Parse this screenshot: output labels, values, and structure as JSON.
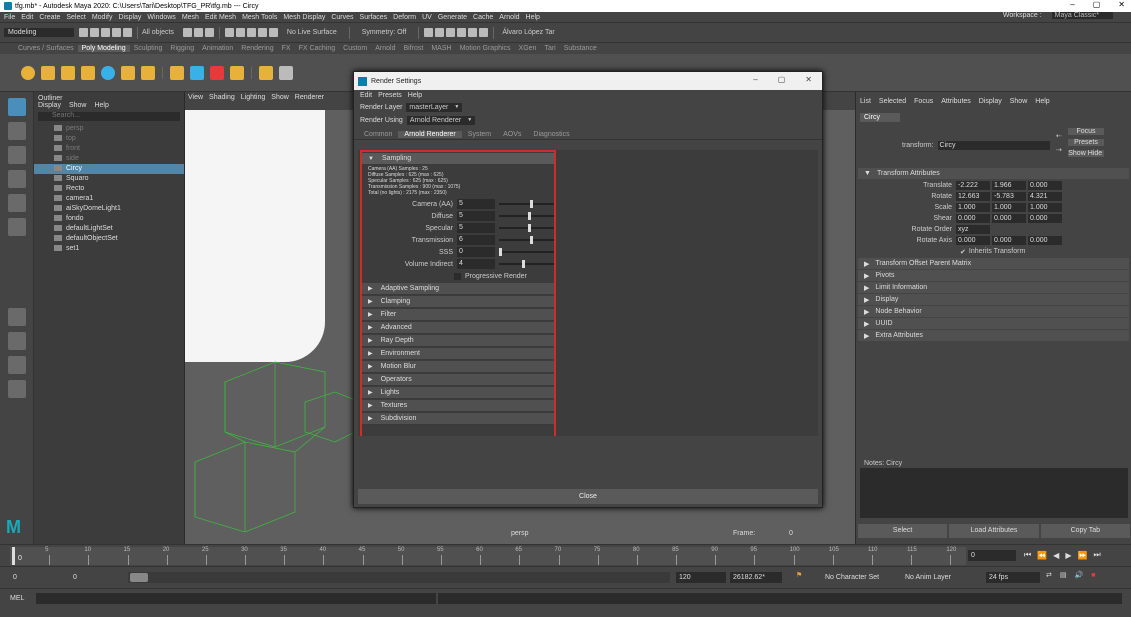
{
  "window": {
    "title": "tfg.mb* - Autodesk Maya 2020: C:\\Users\\Tari\\Desktop\\TFG_PR\\tfg.mb  ---  Circy",
    "controls": [
      "–",
      "▢",
      "✕"
    ]
  },
  "menubar": {
    "items": [
      "File",
      "Edit",
      "Create",
      "Select",
      "Modify",
      "Display",
      "Windows",
      "Mesh",
      "Edit Mesh",
      "Mesh Tools",
      "Mesh Display",
      "Curves",
      "Surfaces",
      "Deform",
      "UV",
      "Generate",
      "Cache",
      "Arnold",
      "Help"
    ],
    "workspace_label": "Workspace :",
    "workspace_value": "Maya Classic*"
  },
  "statusline": {
    "menuset": "Modeling",
    "select_mode": "All objects",
    "live_surface": "No Live Surface",
    "symmetry": "Symmetry: Off",
    "user": "Álvaro López Tar"
  },
  "shelf": {
    "tabs": [
      "Curves / Surfaces",
      "Poly Modeling",
      "Sculpting",
      "Rigging",
      "Animation",
      "Rendering",
      "FX",
      "FX Caching",
      "Custom",
      "Arnold",
      "Bifrost",
      "MASH",
      "Motion Graphics",
      "XGen",
      "Tari",
      "Substance"
    ],
    "active_tab": "Poly Modeling",
    "icon_colors": [
      "#e8b23a",
      "#e8b23a",
      "#e8b23a",
      "#e8b23a",
      "#3ab0e8",
      "#3ab0e8",
      "#e8b23a",
      "#e8b23a",
      "#e83a3a",
      "#3ab0e8",
      "#e8b23a",
      "#e8b23a"
    ]
  },
  "outliner": {
    "title": "Outliner",
    "menu": [
      "Display",
      "Show",
      "Help"
    ],
    "search_placeholder": "Search...",
    "items": [
      {
        "label": "persp",
        "state": "dim"
      },
      {
        "label": "top",
        "state": "dim"
      },
      {
        "label": "front",
        "state": "dim"
      },
      {
        "label": "side",
        "state": "dim"
      },
      {
        "label": "Circy",
        "state": "sel"
      },
      {
        "label": "Squaro",
        "state": "normal"
      },
      {
        "label": "Recto",
        "state": "normal"
      },
      {
        "label": "camera1",
        "state": "normal"
      },
      {
        "label": "aiSkyDomeLight1",
        "state": "normal"
      },
      {
        "label": "fondo",
        "state": "normal"
      },
      {
        "label": "defaultLightSet",
        "state": "normal"
      },
      {
        "label": "defaultObjectSet",
        "state": "normal"
      },
      {
        "label": "set1",
        "state": "normal"
      }
    ]
  },
  "viewport": {
    "menu": [
      "View",
      "Shading",
      "Lighting",
      "Show",
      "Renderer"
    ],
    "camera_label": "persp",
    "frame_label": "Frame:",
    "frame_value": "0"
  },
  "render_settings": {
    "title": "Render Settings",
    "menu": [
      "Edit",
      "Presets",
      "Help"
    ],
    "render_layer_label": "Render Layer",
    "render_layer_value": "masterLayer",
    "render_using_label": "Render Using",
    "render_using_value": "Arnold Renderer",
    "tabs": [
      "Common",
      "Arnold Renderer",
      "System",
      "AOVs",
      "Diagnostics"
    ],
    "active_tab": "Arnold Renderer",
    "sampling_title": "Sampling",
    "stats": [
      "Camera (AA) Samples : 25",
      "Diffuse Samples : 625 (max : 625)",
      "Specular Samples : 625 (max : 625)",
      "Transmission Samples : 900 (max : 1075)",
      "Total (no lights) : 2175 (max : 2350)"
    ],
    "attrs": [
      {
        "label": "Camera (AA)",
        "value": "5",
        "fraction": 0.6
      },
      {
        "label": "Diffuse",
        "value": "5",
        "fraction": 0.55
      },
      {
        "label": "Specular",
        "value": "5",
        "fraction": 0.55
      },
      {
        "label": "Transmission",
        "value": "6",
        "fraction": 0.6
      },
      {
        "label": "SSS",
        "value": "0",
        "fraction": 0.0
      },
      {
        "label": "Volume Indirect",
        "value": "4",
        "fraction": 0.45
      }
    ],
    "progressive_label": "Progressive Render",
    "sampling_subsections": [
      "Adaptive Sampling",
      "Clamping",
      "Filter",
      "Advanced"
    ],
    "sections": [
      "Ray Depth",
      "Environment",
      "Motion Blur",
      "Operators",
      "Lights",
      "Textures",
      "Subdivision"
    ],
    "close_label": "Close"
  },
  "attribute_editor": {
    "menu": [
      "List",
      "Selected",
      "Focus",
      "Attributes",
      "Display",
      "Show",
      "Help"
    ],
    "node_tab": "Circy",
    "transform_label": "transform:",
    "transform_value": "Circy",
    "focus_label": "Focus",
    "presets_label": "Presets",
    "show_label": "Show",
    "hide_label": "Hide",
    "transform_section": "Transform Attributes",
    "translate": {
      "label": "Translate",
      "values": [
        "-2.222",
        "1.966",
        "0.000"
      ]
    },
    "rotate": {
      "label": "Rotate",
      "values": [
        "12.663",
        "-5.783",
        "4.321"
      ]
    },
    "scale": {
      "label": "Scale",
      "values": [
        "1.000",
        "1.000",
        "1.000"
      ]
    },
    "shear": {
      "label": "Shear",
      "values": [
        "0.000",
        "0.000",
        "0.000"
      ]
    },
    "rotate_order": {
      "label": "Rotate Order",
      "value": "xyz"
    },
    "rotate_axis": {
      "label": "Rotate Axis",
      "values": [
        "0.000",
        "0.000",
        "0.000"
      ]
    },
    "inherits": "Inherits Transform",
    "sections": [
      "Transform Offset Parent Matrix",
      "Pivots",
      "Limit Information",
      "Display",
      "Node Behavior",
      "UUID",
      "Extra Attributes"
    ],
    "notes_label": "Notes: Circy",
    "buttons": [
      "Select",
      "Load Attributes",
      "Copy Tab"
    ]
  },
  "timeslider": {
    "ticks": [
      "5",
      "10",
      "15",
      "20",
      "25",
      "30",
      "35",
      "40",
      "45",
      "50",
      "55",
      "60",
      "65",
      "70",
      "75",
      "80",
      "85",
      "90",
      "95",
      "100",
      "105",
      "110",
      "115",
      "120"
    ],
    "current_frame": "0",
    "frame_field": "0"
  },
  "rangeslider": {
    "start": "0",
    "start2": "0",
    "end": "120",
    "end2": "26182.62*",
    "char_set": "No Character Set",
    "anim_layer": "No Anim Layer",
    "fps": "24 fps"
  },
  "cmdline": {
    "label": "MEL"
  }
}
